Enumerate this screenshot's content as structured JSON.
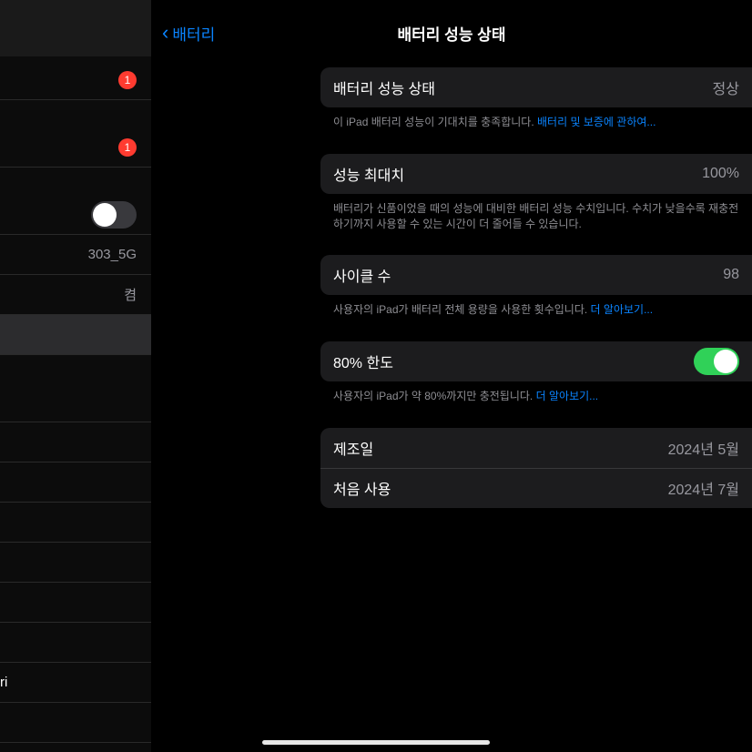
{
  "nav": {
    "back": "배터리",
    "title": "배터리 성능 상태"
  },
  "sidebar": {
    "badge1": "1",
    "badge2": "1",
    "wifi": "303_5G",
    "bt": "켬",
    "safari": "ri"
  },
  "groups": {
    "health": {
      "label": "배터리 성능 상태",
      "value": "정상",
      "footer_prefix": "이 iPad 배터리 성능이 기대치를 충족합니다. ",
      "footer_link": "배터리 및 보증에 관하여..."
    },
    "capacity": {
      "label": "성능 최대치",
      "value": "100%",
      "footer": "배터리가 신품이었을 때의 성능에 대비한 배터리 성능 수치입니다. 수치가 낮을수록 재충전하기까지 사용할 수 있는 시간이 더 줄어들 수 있습니다."
    },
    "cycles": {
      "label": "사이클 수",
      "value": "98",
      "footer_prefix": "사용자의 iPad가 배터리 전체 용량을 사용한 횟수입니다. ",
      "footer_link": "더 알아보기..."
    },
    "limit": {
      "label": "80% 한도",
      "footer_prefix": "사용자의 iPad가 약 80%까지만 충전됩니다. ",
      "footer_link": "더 알아보기..."
    },
    "dates": {
      "mfg_label": "제조일",
      "mfg_value": "2024년 5월",
      "first_label": "처음 사용",
      "first_value": "2024년 7월"
    }
  }
}
